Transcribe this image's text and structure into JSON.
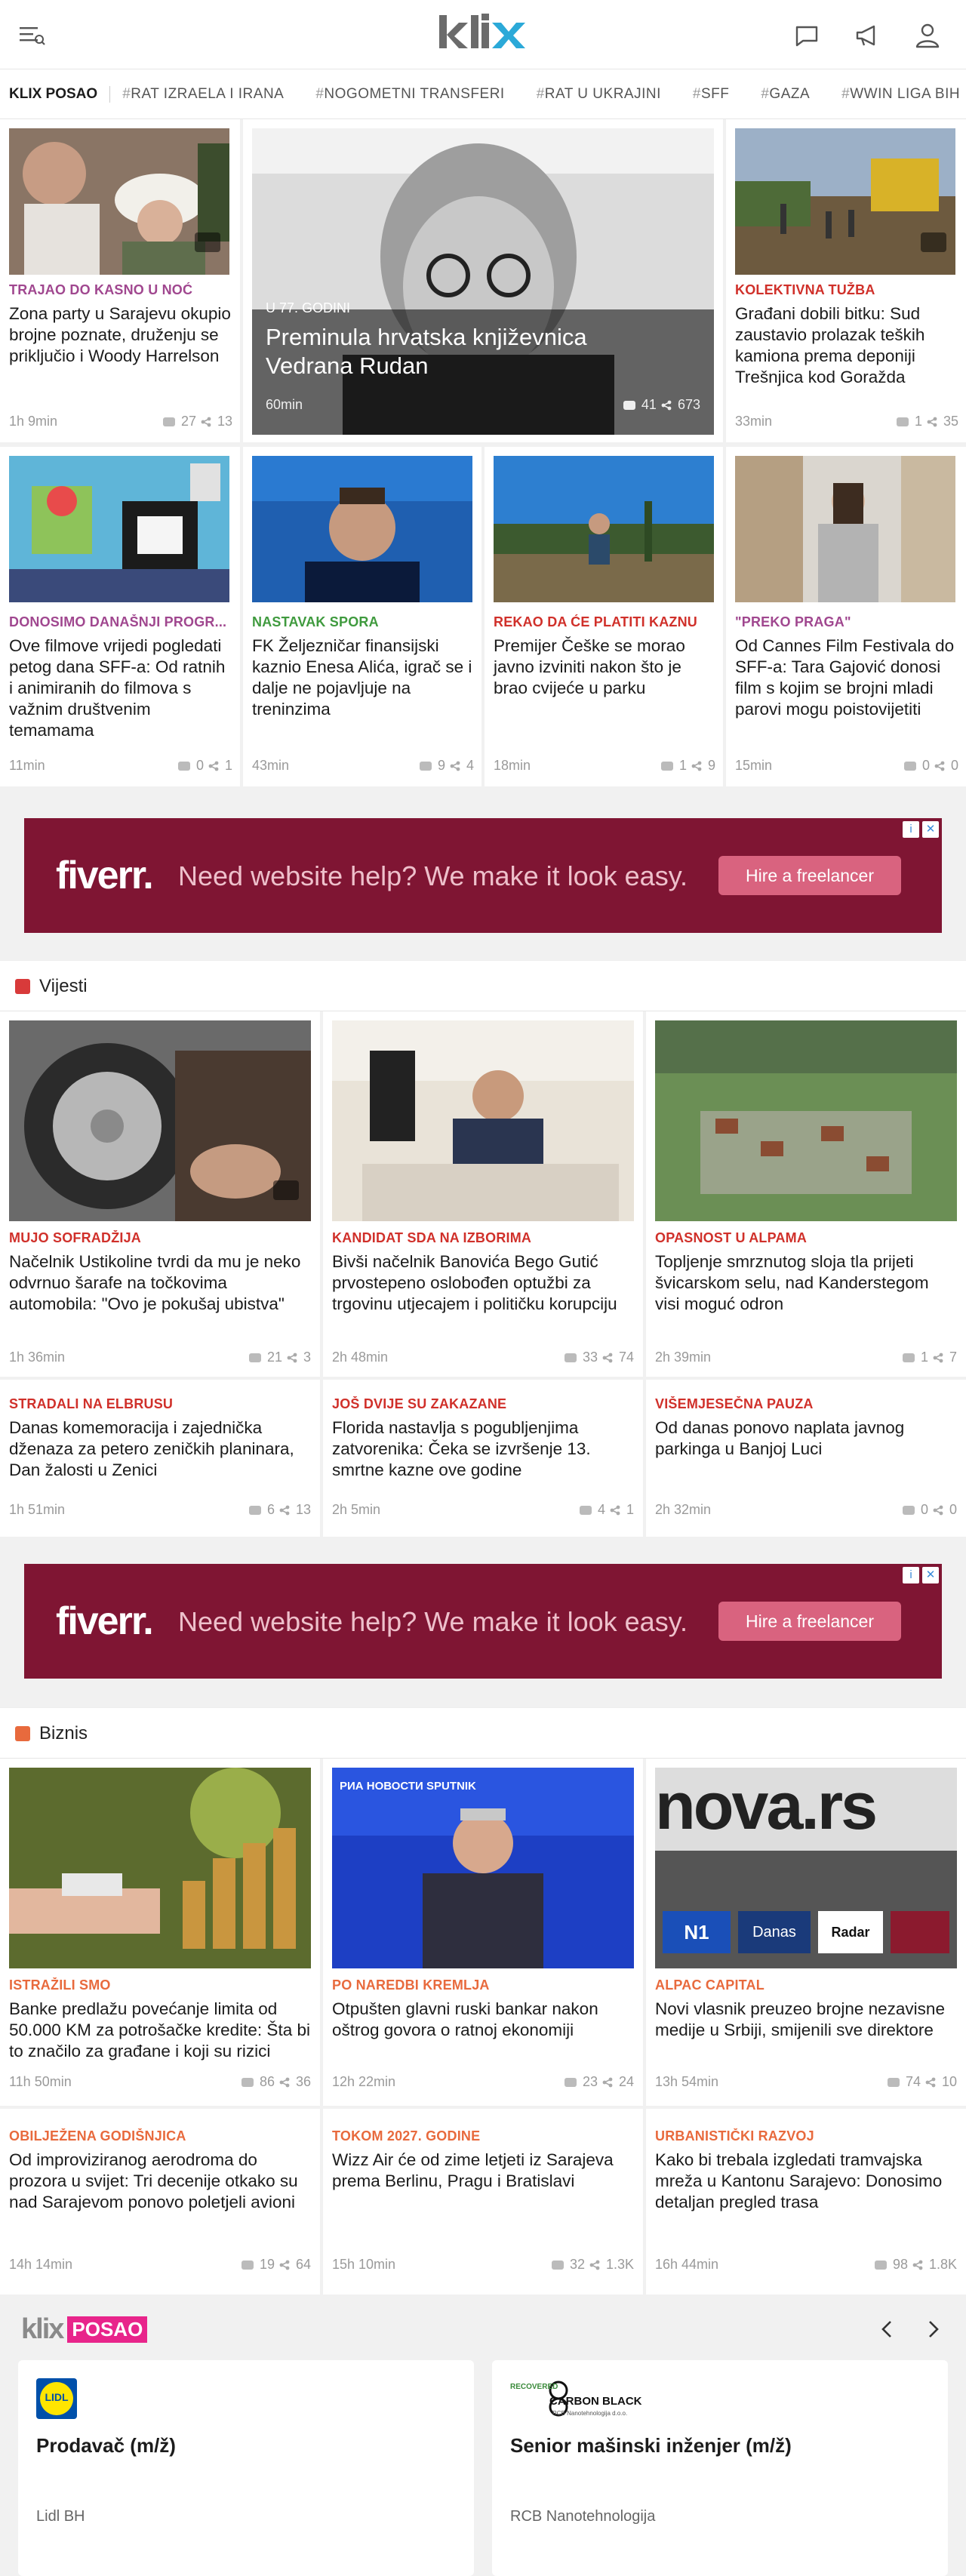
{
  "header": {
    "logo": "klix",
    "logo_colors": {
      "k": "#6b6b6b",
      "x": "#2ba9d8"
    }
  },
  "tags": {
    "posao": "KLIX POSAO",
    "items": [
      "RAT IZRAELA I IRANA",
      "NOGOMETNI TRANSFERI",
      "RAT U UKRAJINI",
      "SFF",
      "GAZA",
      "WWIN LIGA BIH"
    ]
  },
  "top": {
    "c1": {
      "cat": "TRAJAO DO KASNO U NOĆ",
      "title": "Zona party u Sarajevu okupio brojne poznate, druženju se priključio i Woody Harrelson",
      "time": "1h 9min",
      "comments": "27",
      "shares": "13"
    },
    "hero": {
      "cat": "U 77. GODINI",
      "title": "Preminula hrvatska književnica Vedrana Rudan",
      "time": "60min",
      "comments": "41",
      "shares": "673"
    },
    "c3": {
      "cat": "KOLEKTIVNA TUŽBA",
      "title": "Građani dobili bitku: Sud zaustavio prolazak teških kamiona prema deponiji Trešnjica kod Goražda",
      "time": "33min",
      "comments": "1",
      "shares": "35"
    },
    "c4": {
      "cat": "DONOSIMO DANAŠNJI PROGR...",
      "title": "Ove filmove vrijedi pogledati petog dana SFF-a: Od ratnih i animiranih do filmova s važnim društvenim temamama",
      "time": "11min",
      "comments": "0",
      "shares": "1"
    },
    "c5": {
      "cat": "NASTAVAK SPORA",
      "title": "FK Željezničar finansijski kaznio Enesa Alića, igrač se i dalje ne pojavljuje na treninzima",
      "time": "43min",
      "comments": "9",
      "shares": "4"
    },
    "c6": {
      "cat": "REKAO DA ĆE PLATITI KAZNU",
      "title": "Premijer Češke se morao javno izviniti nakon što je brao cvijeće u parku",
      "time": "18min",
      "comments": "1",
      "shares": "9"
    },
    "c7": {
      "cat": "\"PREKO PRAGA\"",
      "title": "Od Cannes Film Festivala do SFF-a: Tara Gajović donosi film s kojim se brojni mladi parovi mogu poistovijetiti",
      "time": "15min",
      "comments": "0",
      "shares": "0"
    }
  },
  "ad": {
    "brand": "fiverr.",
    "text": "Need website help? We make it look easy.",
    "button": "Hire a freelancer"
  },
  "vijesti": {
    "title": "Vijesti",
    "v1": {
      "cat": "MUJO SOFRADŽIJA",
      "title": "Načelnik Ustikoline tvrdi da mu je neko odvrnuo šarafe na točkovima automobila: \"Ovo je pokušaj ubistva\"",
      "time": "1h 36min",
      "comments": "21",
      "shares": "3"
    },
    "v2": {
      "cat": "KANDIDAT SDA NA IZBORIMA",
      "title": "Bivši načelnik Banovića Bego Gutić prvostepeno oslobođen optužbi za trgovinu utjecajem i političku korupciju",
      "time": "2h 48min",
      "comments": "33",
      "shares": "74"
    },
    "v3": {
      "cat": "OPASNOST U ALPAMA",
      "title": "Topljenje smrznutog sloja tla prijeti švicarskom selu, nad Kanderstegom visi moguć odron",
      "time": "2h 39min",
      "comments": "1",
      "shares": "7"
    },
    "v4": {
      "cat": "STRADALI NA ELBRUSU",
      "title": "Danas komemoracija i zajednička dženaza za petero zeničkih planinara, Dan žalosti u Zenici",
      "time": "1h 51min",
      "comments": "6",
      "shares": "13"
    },
    "v5": {
      "cat": "JOŠ DVIJE SU ZAKAZANE",
      "title": "Florida nastavlja s pogubljenjima zatvorenika: Čeka se izvršenje 13. smrtne kazne ove godine",
      "time": "2h 5min",
      "comments": "4",
      "shares": "1"
    },
    "v6": {
      "cat": "VIŠEMJESEČNA PAUZA",
      "title": "Od danas ponovo naplata javnog parkinga u Banjoj Luci",
      "time": "2h 32min",
      "comments": "0",
      "shares": "0"
    }
  },
  "biznis": {
    "title": "Biznis",
    "b1": {
      "cat": "ISTRAŽILI SMO",
      "title": "Banke predlažu povećanje limita od 50.000 KM za potrošačke kredite: Šta bi to značilo za građane i koji su rizici",
      "time": "11h 50min",
      "comments": "86",
      "shares": "36"
    },
    "b2": {
      "cat": "PO NAREDBI KREMLJA",
      "title": "Otpušten glavni ruski bankar nakon oštrog govora o ratnoj ekonomiji",
      "time": "12h 22min",
      "comments": "23",
      "shares": "24"
    },
    "b3": {
      "cat": "ALPAC CAPITAL",
      "title": "Novi vlasnik preuzeo brojne nezavisne medije u Srbiji, smijenili sve direktore",
      "time": "13h 54min",
      "comments": "74",
      "shares": "10"
    },
    "b4": {
      "cat": "OBILJEŽENA GODIŠNJICA",
      "title": "Od improviziranog aerodroma do prozora u svijet: Tri decenije otkako su nad Sarajevom ponovo poletjeli avioni",
      "time": "14h 14min",
      "comments": "19",
      "shares": "64"
    },
    "b5": {
      "cat": "TOKOM 2027. GODINE",
      "title": "Wizz Air će od zime letjeti iz Sarajeva prema Berlinu, Pragu i Bratislavi",
      "time": "15h 10min",
      "comments": "32",
      "shares": "1.3K"
    },
    "b6": {
      "cat": "URBANISTIČKI RAZVOJ",
      "title": "Kako bi trebala izgledati tramvajska mreža u Kantonu Sarajevo: Donosimo detaljan pregled trasa",
      "time": "16h 44min",
      "comments": "98",
      "shares": "1.8K"
    },
    "b2_img_text": "РИА НОВОСТИ  SPUTNIK",
    "b3_img_text": {
      "big": "nova.rs",
      "n1": "N1",
      "danas": "Danas",
      "radar": "Radar"
    }
  },
  "posao": {
    "logo_klix": "klix",
    "logo_posao": "POSAO",
    "jobs": [
      {
        "logo": "LIDL",
        "title": "Prodavač (m/ž)",
        "company": "Lidl BH"
      },
      {
        "logo_top": "RECOVERED",
        "logo_main": "CARBON BLACK",
        "logo_sub": "RCB Nanotehnologija d.o.o.",
        "title": "Senior mašinski inženjer (m/ž)",
        "company": "RCB Nanotehnologija"
      }
    ]
  },
  "colors": {
    "purple": "#a0478f",
    "red": "#d0302a",
    "green": "#3f9a3e",
    "brand_blue": "#2ba9d8",
    "posao_pink": "#e8258b",
    "vijesti": "#d83a3a",
    "biznis": "#e86a3d"
  }
}
